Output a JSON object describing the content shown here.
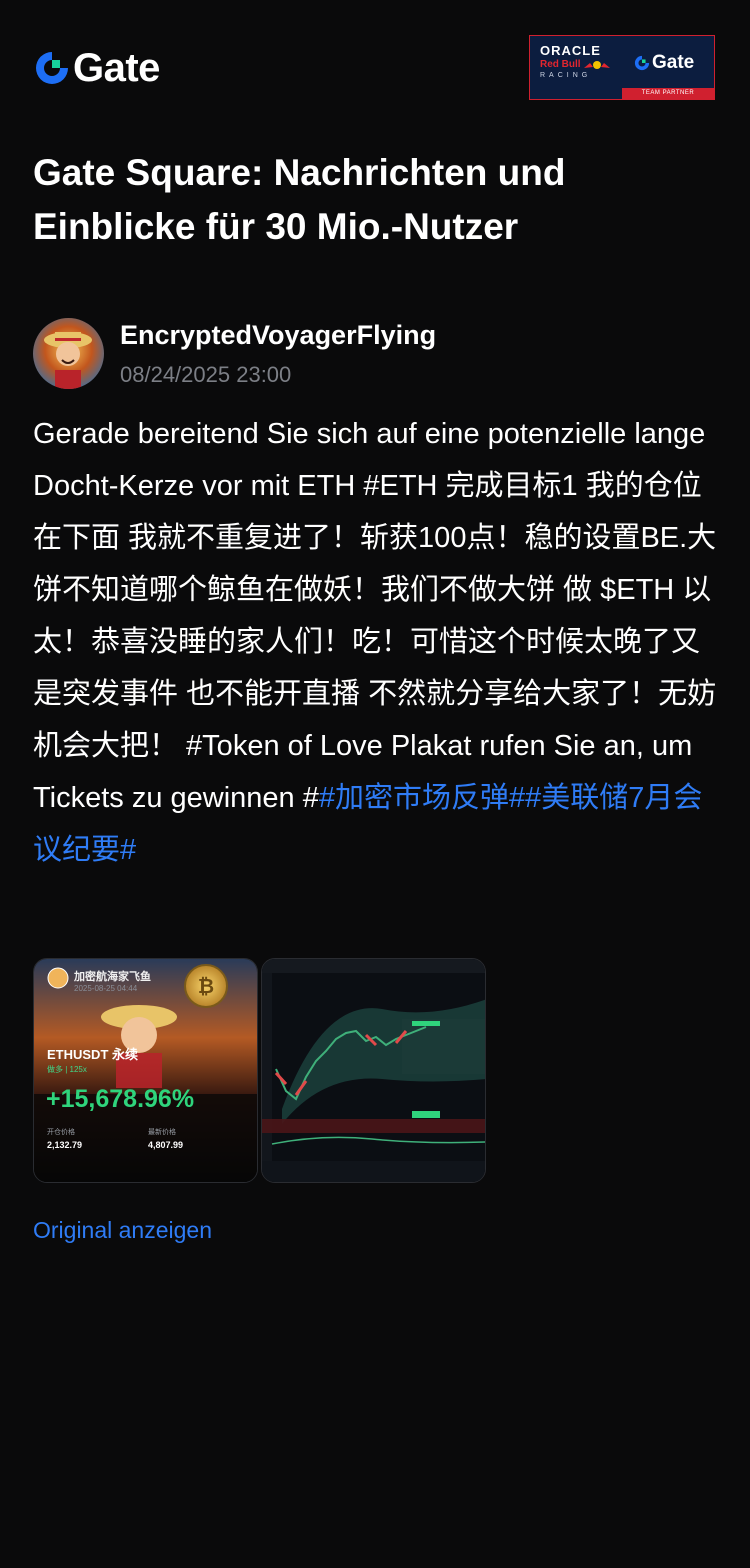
{
  "header": {
    "logo_text": "Gate",
    "partner_badge": {
      "oracle": "ORACLE",
      "redbull": "Red Bull",
      "racing": "RACING",
      "gate": "Gate",
      "team_partner": "TEAM PARTNER"
    }
  },
  "page_title": "Gate Square: Nachrichten und Einblicke für 30 Mio.-Nutzer",
  "post": {
    "author": "EncryptedVoyagerFlying",
    "time": "08/24/2025 23:00",
    "body_text": "Gerade bereitend Sie sich auf eine potenzielle lange Docht-Kerze vor mit ETH #ETH 完成目标1 我的仓位在下面 我就不重复进了！斩获100点！稳的设置BE.大饼不知道哪个鲸鱼在做妖！我们不做大饼 做 $ETH 以太！恭喜没睡的家人们！吃！可惜这个时候太晚了又是突发事件 也不能开直播 不然就分享给大家了！无妨 机会大把！ #Token of Love Plakat rufen Sie an, um Tickets zu gewinnen #",
    "hashtags": [
      "#加密市场反弹#",
      "#美联储7月会议纪要#"
    ],
    "thumbnail_1": {
      "username": "加密航海家飞鱼",
      "date": "2025-08-25 04:44",
      "pair": "ETHUSDT 永续",
      "side": "做多 | 125x",
      "pnl": "+15,678.96%",
      "entry_label": "开仓价格",
      "entry_value": "2,132.79",
      "last_label": "最新价格",
      "last_value": "4,807.99"
    },
    "show_original": "Original anzeigen"
  },
  "colors": {
    "background": "#0a0a0b",
    "link_blue": "#2f7cf6",
    "brand_blue": "#1d6ef5",
    "brand_green": "#17d39b",
    "muted_gray": "#7c7f86"
  }
}
